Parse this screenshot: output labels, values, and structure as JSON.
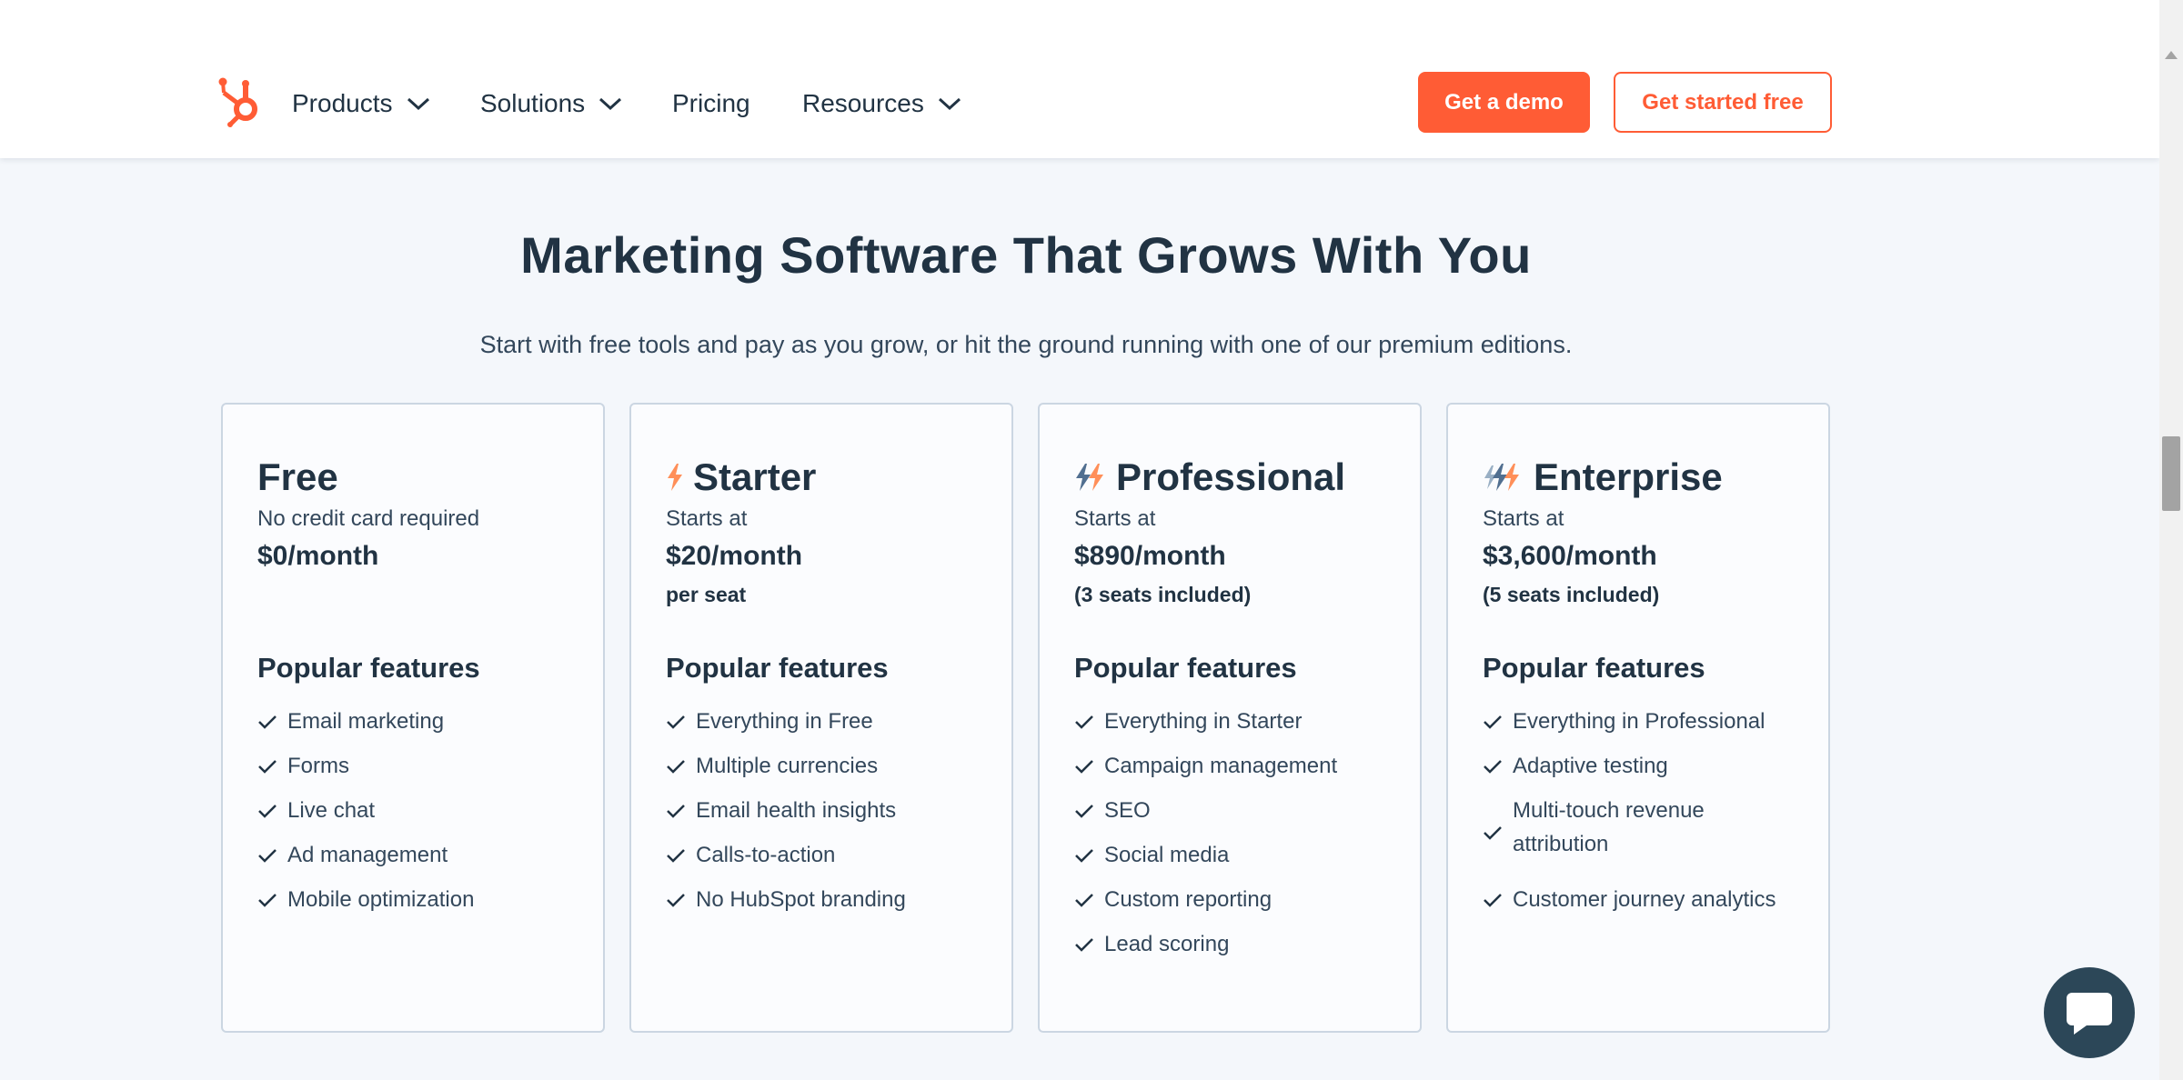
{
  "nav": {
    "items": [
      {
        "label": "Products",
        "has_dropdown": true
      },
      {
        "label": "Solutions",
        "has_dropdown": true
      },
      {
        "label": "Pricing",
        "has_dropdown": false
      },
      {
        "label": "Resources",
        "has_dropdown": true
      }
    ],
    "demo_button": "Get a demo",
    "free_button": "Get started free",
    "logo_icon": "hubspot-sprocket-icon"
  },
  "hero": {
    "title": "Marketing Software That Grows With You",
    "subtitle": "Start with free tools and pay as you grow, or hit the ground running with one of our premium editions."
  },
  "plans": [
    {
      "name": "Free",
      "icon": "",
      "starts_label": "No credit card required",
      "price": "$0/month",
      "seats": "",
      "features_heading": "Popular features",
      "features": [
        "Email marketing",
        "Forms",
        "Live chat",
        "Ad management",
        "Mobile optimization"
      ]
    },
    {
      "name": "Starter",
      "icon": "starter-tier-icon",
      "starts_label": "Starts at",
      "price": "$20/month",
      "seats": "per seat",
      "features_heading": "Popular features",
      "features": [
        "Everything in Free",
        "Multiple currencies",
        "Email health insights",
        "Calls-to-action",
        "No HubSpot branding"
      ]
    },
    {
      "name": "Professional",
      "icon": "professional-tier-icon",
      "starts_label": "Starts at",
      "price": "$890/month",
      "seats": "(3 seats included)",
      "features_heading": "Popular features",
      "features": [
        "Everything in Starter",
        "Campaign management",
        "SEO",
        "Social media",
        "Custom reporting",
        "Lead scoring"
      ]
    },
    {
      "name": "Enterprise",
      "icon": "enterprise-tier-icon",
      "starts_label": "Starts at",
      "price": "$3,600/month",
      "seats": "(5 seats included)",
      "features_heading": "Popular features",
      "features": [
        "Everything in Professional",
        "Adaptive testing",
        "Multi-touch revenue attribution",
        "Customer journey analytics"
      ]
    }
  ],
  "chat": {
    "icon": "chat-bubble-icon"
  },
  "colors": {
    "accent": "#ff5c35",
    "text": "#213343",
    "chat": "#2c4758"
  }
}
